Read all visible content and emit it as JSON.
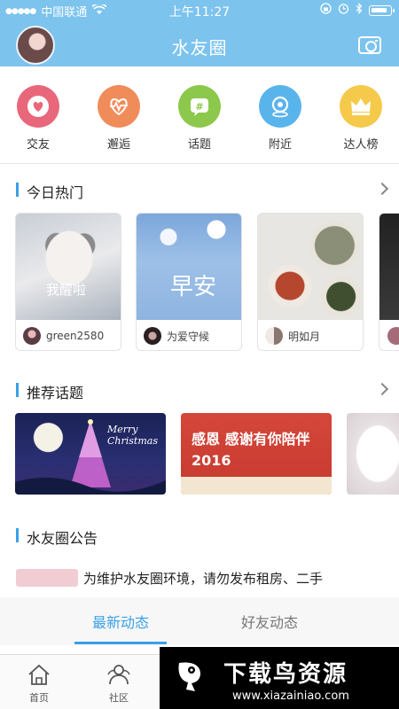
{
  "status_bar": {
    "carrier": "中国联通",
    "time": "上午11:27",
    "battery_level": 0.92
  },
  "header": {
    "title": "水友圈"
  },
  "quick_actions": [
    {
      "label": "交友",
      "icon": "heart-icon",
      "color": "#e9677a"
    },
    {
      "label": "邂逅",
      "icon": "heartbeat-icon",
      "color": "#f08c5a"
    },
    {
      "label": "话题",
      "icon": "hash-icon",
      "color": "#8cc84b"
    },
    {
      "label": "附近",
      "icon": "location-icon",
      "color": "#5ab4ec"
    },
    {
      "label": "达人榜",
      "icon": "crown-icon",
      "color": "#f5c94a"
    }
  ],
  "hot_today": {
    "title": "今日热门",
    "cards": [
      {
        "user": "green2580",
        "overlay_text": "我醒啦"
      },
      {
        "user": "为爱守候",
        "overlay_text": "早安"
      },
      {
        "user": "明如月",
        "overlay_text": ""
      }
    ]
  },
  "recommended_topics": {
    "title": "推荐话题",
    "cards": [
      {
        "caption": "Merry Christmas"
      },
      {
        "caption": "感恩 感谢有你陪伴 2016"
      }
    ]
  },
  "notice": {
    "title": "水友圈公告",
    "text": "为维护水友圈环境，请勿发布租房、二手"
  },
  "feed_tabs": [
    {
      "label": "最新动态",
      "active": true
    },
    {
      "label": "好友动态",
      "active": false
    }
  ],
  "tab_bar": [
    {
      "label": "首页",
      "icon": "home-icon"
    },
    {
      "label": "社区",
      "icon": "community-icon"
    }
  ],
  "watermark": {
    "title": "下载鸟资源",
    "url": "www.xiazainiao.com"
  },
  "colors": {
    "header": "#7cc3ee",
    "accent": "#3aa0e8"
  }
}
